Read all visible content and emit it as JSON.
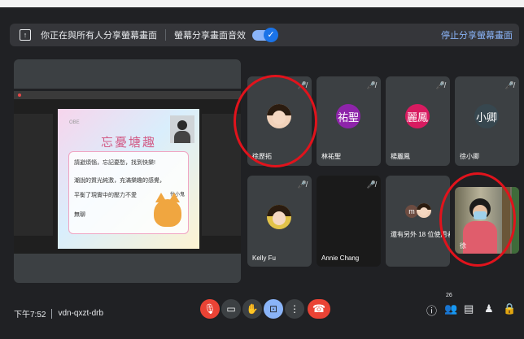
{
  "share_bar": {
    "message": "你正在與所有人分享螢幕畫面",
    "audio_label": "螢幕分享畫面音效",
    "stop_label": "停止分享螢幕畫面"
  },
  "slide": {
    "tag": "OBE",
    "title": "忘憂塘趣",
    "lines": [
      "請避煩惱，忘記憂愁，找到快樂!",
      "潮說的質光純激，充滿樂趣的感覺，",
      "平衡了現實中的壓力不愛",
      "無聊"
    ],
    "note": "忙小鬼"
  },
  "participants": [
    {
      "name": "徐歷拓",
      "avatar_type": "photo"
    },
    {
      "name": "林祐聖",
      "avatar_text": "祐聖",
      "avatar_color": "#8e24aa"
    },
    {
      "name": "楊麗鳳",
      "avatar_text": "麗鳳",
      "avatar_color": "#d81b60"
    },
    {
      "name": "徐小卿",
      "avatar_text": "小卿",
      "avatar_color": "#37474f"
    },
    {
      "name": "Kelly Fu",
      "avatar_type": "photo"
    },
    {
      "name": "Annie Chang",
      "avatar_type": "none"
    },
    {
      "name": "還有另外 18 位使用者",
      "avatar_text": "m",
      "avatar_color": "#6d4c41"
    },
    {
      "name": "徐",
      "avatar_type": "camera"
    }
  ],
  "footer": {
    "time": "下午7:52",
    "meeting_code": "vdn-qxzt-drb",
    "people_count": "26"
  },
  "colors": {
    "highlight_circle": "#e1131c",
    "accent": "#8ab4f8",
    "danger": "#ea4335"
  }
}
